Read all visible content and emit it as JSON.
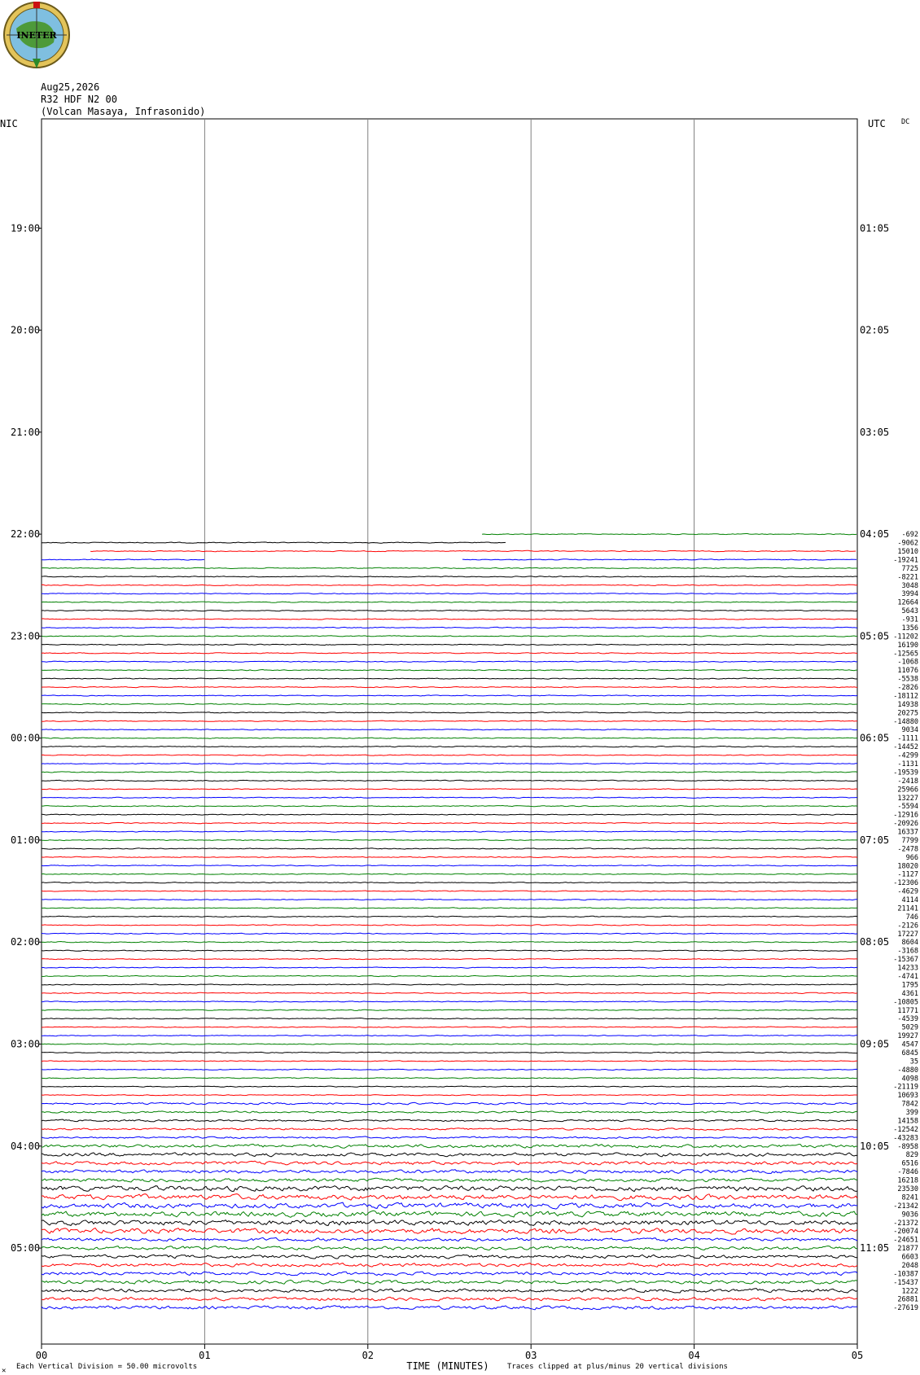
{
  "header": {
    "logo_text": "INETER",
    "date": "Aug25,2026",
    "station": "R32 HDF N2 00",
    "location": "(Volcan Masaya, Infrasonido)",
    "left_zone": "NIC",
    "right_zone": "UTC",
    "dc_label": "DC"
  },
  "footer": {
    "xlabel": "TIME (MINUTES)",
    "scale_note": "Each Vertical Division =   50.00 microvolts",
    "clip_note": "Traces clipped at plus/minus 20 vertical divisions",
    "corner_mark": "✕"
  },
  "colors": {
    "cycle": [
      "#008000",
      "#000000",
      "#ff0000",
      "#0000ff"
    ],
    "grid": "#808080"
  },
  "chart_data": {
    "type": "line",
    "subtype": "helicorder",
    "x_ticks": [
      "00",
      "01",
      "02",
      "03",
      "04",
      "05"
    ],
    "xlim": [
      0,
      5
    ],
    "time_labels_left": [
      "19:00",
      "20:00",
      "21:00",
      "22:00",
      "23:00",
      "00:00",
      "01:00",
      "02:00",
      "03:00",
      "04:00",
      "05:00"
    ],
    "time_labels_right": [
      "01:05",
      "02:05",
      "03:05",
      "04:05",
      "05:05",
      "06:05",
      "07:05",
      "08:05",
      "09:05",
      "10:05",
      "11:05"
    ],
    "trace_start_row": 48,
    "partial_traces": [
      {
        "row": 48,
        "start_min": 2.7,
        "end_min": 5.0
      },
      {
        "row": 49,
        "start_min": 0.0,
        "end_min": 2.85
      },
      {
        "row": 50,
        "start_min": 0.3,
        "end_min": 5.0
      },
      {
        "row": 51,
        "start_min": 0.0,
        "end_min": 1.0
      },
      {
        "row": 51,
        "start_min": 2.58,
        "end_min": 5.0
      },
      {
        "row": 143,
        "start_min": 0.0,
        "end_min": 1.4
      }
    ],
    "dc_values": [
      "-692",
      "-9062",
      "15010",
      "-19241",
      "7725",
      "-8221",
      "3048",
      "3994",
      "12664",
      "5643",
      "-931",
      "1356",
      "-11202",
      "16190",
      "-12565",
      "-1068",
      "11076",
      "-5538",
      "-2826",
      "-18112",
      "14938",
      "20275",
      "-14880",
      "9034",
      "-1111",
      "-14452",
      "-4299",
      "-1131",
      "-19539",
      "-2418",
      "25966",
      "13227",
      "-5594",
      "-12916",
      "-20926",
      "16337",
      "7799",
      "-2478",
      "966",
      "18020",
      "-1127",
      "-12306",
      "-4629",
      "4114",
      "21141",
      "746",
      "-2126",
      "17227",
      "8604",
      "-3168",
      "-15367",
      "14233",
      "-4741",
      "1795",
      "4361",
      "-10805",
      "11771",
      "-4539",
      "5029",
      "19927",
      "4547",
      "6845",
      "35",
      "-4880",
      "4098",
      "-21119",
      "10693",
      "7842",
      "399",
      "14158",
      "-12542",
      "-43283",
      "-8958",
      "829",
      "6516",
      "-7846",
      "16218",
      "23530",
      "8241",
      "-21342",
      "9036",
      "-21372",
      "-20074",
      "-24651",
      "21877",
      "6603",
      "2048",
      "-10387",
      "-15437",
      "1222",
      "26881",
      "-27619"
    ]
  }
}
